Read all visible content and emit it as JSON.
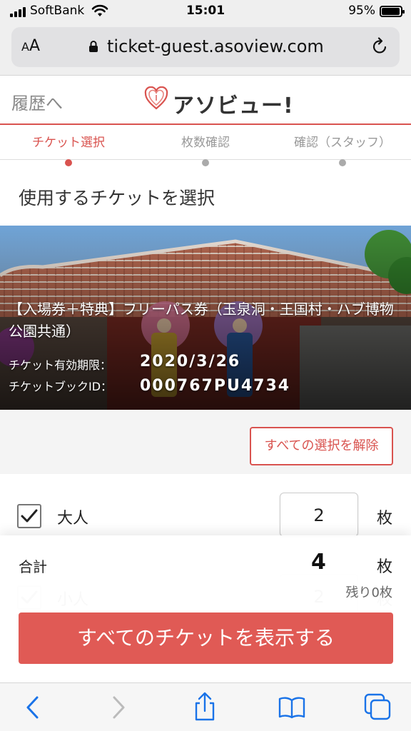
{
  "status_bar": {
    "carrier": "SoftBank",
    "time": "15:01",
    "battery": "95%",
    "battery_level": 0.95
  },
  "browser": {
    "text_size_button": "AA",
    "url": "ticket-guest.asoview.com"
  },
  "header": {
    "back_link": "履歴へ",
    "logo_text": "アソビュー!"
  },
  "steps": [
    {
      "label": "チケット選択",
      "active": true
    },
    {
      "label": "枚数確認",
      "active": false
    },
    {
      "label": "確認（スタッフ）",
      "active": false
    }
  ],
  "page_heading": "使用するチケットを選択",
  "ticket": {
    "title": "【入場券＋特典】フリーパス券（玉泉洞・王国村・ハブ博物公園共通）",
    "expiry_label": "チケット有効期限：",
    "expiry_value": "2020/3/26",
    "book_id_label": "チケットブックID：",
    "book_id_value": "000767PU4734"
  },
  "clear_button": "すべての選択を解除",
  "rows": [
    {
      "label": "大人",
      "quantity": "2",
      "unit": "枚",
      "checked": true
    },
    {
      "label": "小人",
      "quantity": "2",
      "unit": "枚",
      "checked": true
    }
  ],
  "total": {
    "label": "合計",
    "count": "4",
    "unit": "枚",
    "remaining": "残り0枚"
  },
  "show_all_button": "すべてのチケットを表示する",
  "colors": {
    "accent": "#d9534f",
    "button": "#e05a55"
  }
}
